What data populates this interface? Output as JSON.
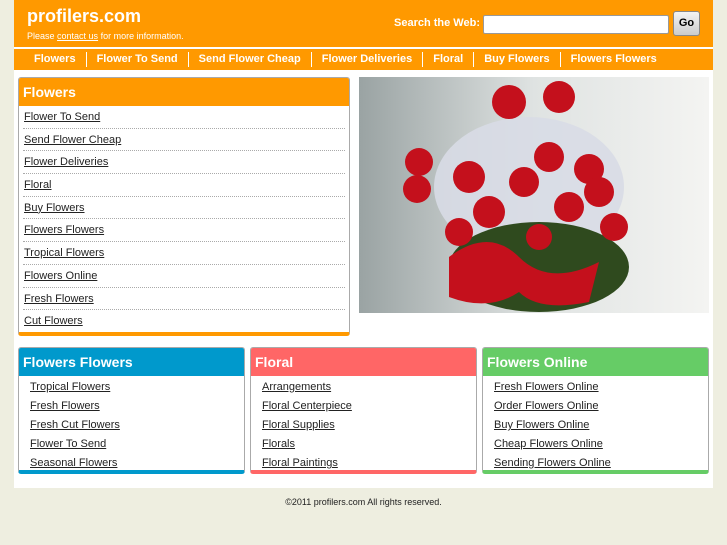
{
  "header": {
    "logo": "profilers.com",
    "tag_pre": "Please ",
    "tag_link": "contact us",
    "tag_post": " for more information.",
    "search_label": "Search the Web:",
    "search_value": "",
    "go": "Go"
  },
  "nav": [
    "Flowers",
    "Flower To Send",
    "Send Flower Cheap",
    "Flower Deliveries",
    "Floral",
    "Buy Flowers",
    "Flowers Flowers"
  ],
  "main_box": {
    "title": "Flowers",
    "links": [
      "Flower To Send",
      "Send Flower Cheap",
      "Flower Deliveries",
      "Floral",
      "Buy Flowers",
      "Flowers Flowers",
      "Tropical Flowers",
      "Flowers Online",
      "Fresh Flowers",
      "Cut Flowers"
    ]
  },
  "boxes": [
    {
      "title": "Flowers Flowers",
      "color": "#0099cc",
      "links": [
        "Tropical Flowers",
        "Fresh Flowers",
        "Fresh Cut Flowers",
        "Flower To Send",
        "Seasonal Flowers"
      ]
    },
    {
      "title": "Floral",
      "color": "#ff6666",
      "links": [
        "Arrangements",
        "Floral Centerpiece",
        "Floral Supplies",
        "Florals",
        "Floral Paintings"
      ]
    },
    {
      "title": "Flowers Online",
      "color": "#66cc66",
      "links": [
        "Fresh Flowers Online",
        "Order Flowers Online",
        "Buy Flowers Online",
        "Cheap Flowers Online",
        "Sending Flowers Online"
      ]
    }
  ],
  "footer": "©2011 profilers.com All rights reserved."
}
